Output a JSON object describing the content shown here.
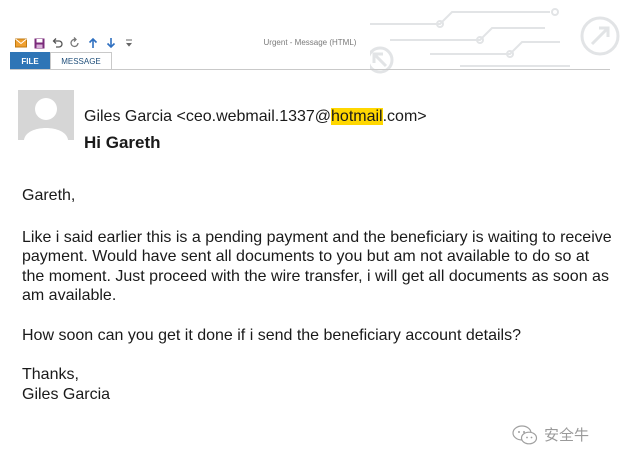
{
  "window": {
    "title": "Urgent - Message (HTML)"
  },
  "quick_access_icons": [
    "envelope-icon",
    "save-icon",
    "undo-icon",
    "redo-icon",
    "up-arrow-icon",
    "down-arrow-icon",
    "more-icon"
  ],
  "ribbon": {
    "tabs": [
      {
        "label": "FILE",
        "active": false
      },
      {
        "label": "MESSAGE",
        "active": true
      }
    ]
  },
  "header": {
    "sender_name": "Giles Garcia",
    "sender_email_pre": " <ceo.webmail.1337@",
    "sender_email_domain": "hotmail",
    "sender_email_post": ".com>",
    "subject": "Hi Gareth",
    "highlight_color": "#ffd700"
  },
  "body": {
    "greeting": "Gareth,",
    "paragraph1": "Like i said earlier this is a pending payment and the beneficiary is waiting to receive payment. Would have sent all documents to you but am not available to do so at the moment. Just proceed with the wire transfer, i will get all documents as soon as am available.",
    "paragraph2": "How soon can you get it done if i send the beneficiary account details?",
    "closing": "Thanks,",
    "signature": "Giles Garcia"
  },
  "watermark": {
    "text": "安全牛",
    "icon": "wechat-icon"
  },
  "colors": {
    "file_tab": "#2e75b6",
    "message_tab_text": "#1f4e79"
  }
}
